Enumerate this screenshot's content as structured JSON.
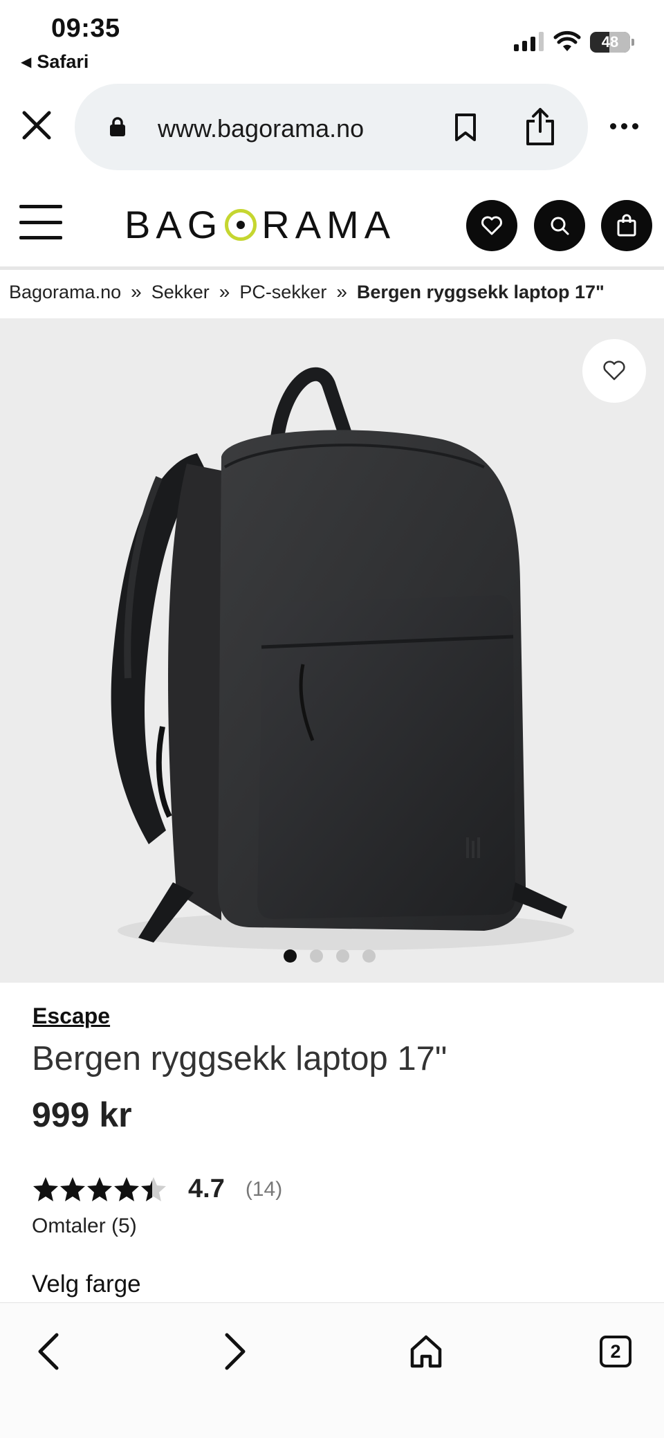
{
  "status_bar": {
    "time": "09:35",
    "back_app": "Safari",
    "battery": "48"
  },
  "browser": {
    "url": "www.bagorama.no",
    "tab_count": "2"
  },
  "site": {
    "logo_left": "BAG",
    "logo_right": "RAMA",
    "accent_color": "#c5d630"
  },
  "breadcrumb": [
    {
      "label": "Bagorama.no"
    },
    {
      "label": "Sekker"
    },
    {
      "label": "PC-sekker"
    },
    {
      "label": "Bergen ryggsekk laptop 17\""
    }
  ],
  "breadcrumb_separator": "»",
  "gallery": {
    "image_count": 4,
    "active_index": 0
  },
  "product": {
    "brand": "Escape",
    "name": "Bergen ryggsekk laptop 17\"",
    "price": "999 kr",
    "rating": "4.7",
    "rating_count": "(14)",
    "reviews": "Omtaler (5)",
    "color_label": "Velg farge"
  }
}
